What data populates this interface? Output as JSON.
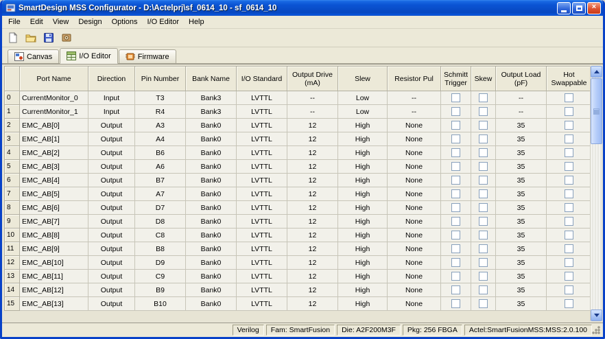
{
  "window": {
    "title": "SmartDesign MSS Configurator - D:\\Actelprj\\sf_0614_10 - sf_0614_10"
  },
  "menu": {
    "items": [
      "File",
      "Edit",
      "View",
      "Design",
      "Options",
      "I/O Editor",
      "Help"
    ]
  },
  "toolbar": {
    "buttons": [
      "New",
      "Open",
      "Save",
      "Generate"
    ]
  },
  "tabs": [
    {
      "label": "Canvas",
      "selected": false
    },
    {
      "label": "I/O Editor",
      "selected": true
    },
    {
      "label": "Firmware",
      "selected": false
    }
  ],
  "table": {
    "columns": [
      "Port Name",
      "Direction",
      "Pin Number",
      "Bank Name",
      "I/O Standard",
      "Output Drive (mA)",
      "Slew",
      "Resistor Pul",
      "Schmitt Trigger",
      "Skew",
      "Output Load (pF)",
      "Hot Swappable"
    ],
    "rows": [
      {
        "index": "0",
        "port": "CurrentMonitor_0",
        "direction": "Input",
        "pin": "T3",
        "bank": "Bank3",
        "standard": "LVTTL",
        "drive": "--",
        "slew": "Low",
        "resistor": "--",
        "schmitt": false,
        "skew": false,
        "load": "--",
        "hot": false
      },
      {
        "index": "1",
        "port": "CurrentMonitor_1",
        "direction": "Input",
        "pin": "R4",
        "bank": "Bank3",
        "standard": "LVTTL",
        "drive": "--",
        "slew": "Low",
        "resistor": "--",
        "schmitt": false,
        "skew": false,
        "load": "--",
        "hot": false
      },
      {
        "index": "2",
        "port": "EMC_AB[0]",
        "direction": "Output",
        "pin": "A3",
        "bank": "Bank0",
        "standard": "LVTTL",
        "drive": "12",
        "slew": "High",
        "resistor": "None",
        "schmitt": false,
        "skew": false,
        "load": "35",
        "hot": false
      },
      {
        "index": "3",
        "port": "EMC_AB[1]",
        "direction": "Output",
        "pin": "A4",
        "bank": "Bank0",
        "standard": "LVTTL",
        "drive": "12",
        "slew": "High",
        "resistor": "None",
        "schmitt": false,
        "skew": false,
        "load": "35",
        "hot": false
      },
      {
        "index": "4",
        "port": "EMC_AB[2]",
        "direction": "Output",
        "pin": "B6",
        "bank": "Bank0",
        "standard": "LVTTL",
        "drive": "12",
        "slew": "High",
        "resistor": "None",
        "schmitt": false,
        "skew": false,
        "load": "35",
        "hot": false
      },
      {
        "index": "5",
        "port": "EMC_AB[3]",
        "direction": "Output",
        "pin": "A6",
        "bank": "Bank0",
        "standard": "LVTTL",
        "drive": "12",
        "slew": "High",
        "resistor": "None",
        "schmitt": false,
        "skew": false,
        "load": "35",
        "hot": false
      },
      {
        "index": "6",
        "port": "EMC_AB[4]",
        "direction": "Output",
        "pin": "B7",
        "bank": "Bank0",
        "standard": "LVTTL",
        "drive": "12",
        "slew": "High",
        "resistor": "None",
        "schmitt": false,
        "skew": false,
        "load": "35",
        "hot": false
      },
      {
        "index": "7",
        "port": "EMC_AB[5]",
        "direction": "Output",
        "pin": "A7",
        "bank": "Bank0",
        "standard": "LVTTL",
        "drive": "12",
        "slew": "High",
        "resistor": "None",
        "schmitt": false,
        "skew": false,
        "load": "35",
        "hot": false
      },
      {
        "index": "8",
        "port": "EMC_AB[6]",
        "direction": "Output",
        "pin": "D7",
        "bank": "Bank0",
        "standard": "LVTTL",
        "drive": "12",
        "slew": "High",
        "resistor": "None",
        "schmitt": false,
        "skew": false,
        "load": "35",
        "hot": false
      },
      {
        "index": "9",
        "port": "EMC_AB[7]",
        "direction": "Output",
        "pin": "D8",
        "bank": "Bank0",
        "standard": "LVTTL",
        "drive": "12",
        "slew": "High",
        "resistor": "None",
        "schmitt": false,
        "skew": false,
        "load": "35",
        "hot": false
      },
      {
        "index": "10",
        "port": "EMC_AB[8]",
        "direction": "Output",
        "pin": "C8",
        "bank": "Bank0",
        "standard": "LVTTL",
        "drive": "12",
        "slew": "High",
        "resistor": "None",
        "schmitt": false,
        "skew": false,
        "load": "35",
        "hot": false
      },
      {
        "index": "11",
        "port": "EMC_AB[9]",
        "direction": "Output",
        "pin": "B8",
        "bank": "Bank0",
        "standard": "LVTTL",
        "drive": "12",
        "slew": "High",
        "resistor": "None",
        "schmitt": false,
        "skew": false,
        "load": "35",
        "hot": false
      },
      {
        "index": "12",
        "port": "EMC_AB[10]",
        "direction": "Output",
        "pin": "D9",
        "bank": "Bank0",
        "standard": "LVTTL",
        "drive": "12",
        "slew": "High",
        "resistor": "None",
        "schmitt": false,
        "skew": false,
        "load": "35",
        "hot": false
      },
      {
        "index": "13",
        "port": "EMC_AB[11]",
        "direction": "Output",
        "pin": "C9",
        "bank": "Bank0",
        "standard": "LVTTL",
        "drive": "12",
        "slew": "High",
        "resistor": "None",
        "schmitt": false,
        "skew": false,
        "load": "35",
        "hot": false
      },
      {
        "index": "14",
        "port": "EMC_AB[12]",
        "direction": "Output",
        "pin": "B9",
        "bank": "Bank0",
        "standard": "LVTTL",
        "drive": "12",
        "slew": "High",
        "resistor": "None",
        "schmitt": false,
        "skew": false,
        "load": "35",
        "hot": false
      },
      {
        "index": "15",
        "port": "EMC_AB[13]",
        "direction": "Output",
        "pin": "B10",
        "bank": "Bank0",
        "standard": "LVTTL",
        "drive": "12",
        "slew": "High",
        "resistor": "None",
        "schmitt": false,
        "skew": false,
        "load": "35",
        "hot": false
      }
    ]
  },
  "statusbar": {
    "items": [
      "Verilog",
      "Fam: SmartFusion",
      "Die: A2F200M3F",
      "Pkg: 256 FBGA",
      "Actel:SmartFusionMSS:MSS:2.0.100"
    ]
  }
}
